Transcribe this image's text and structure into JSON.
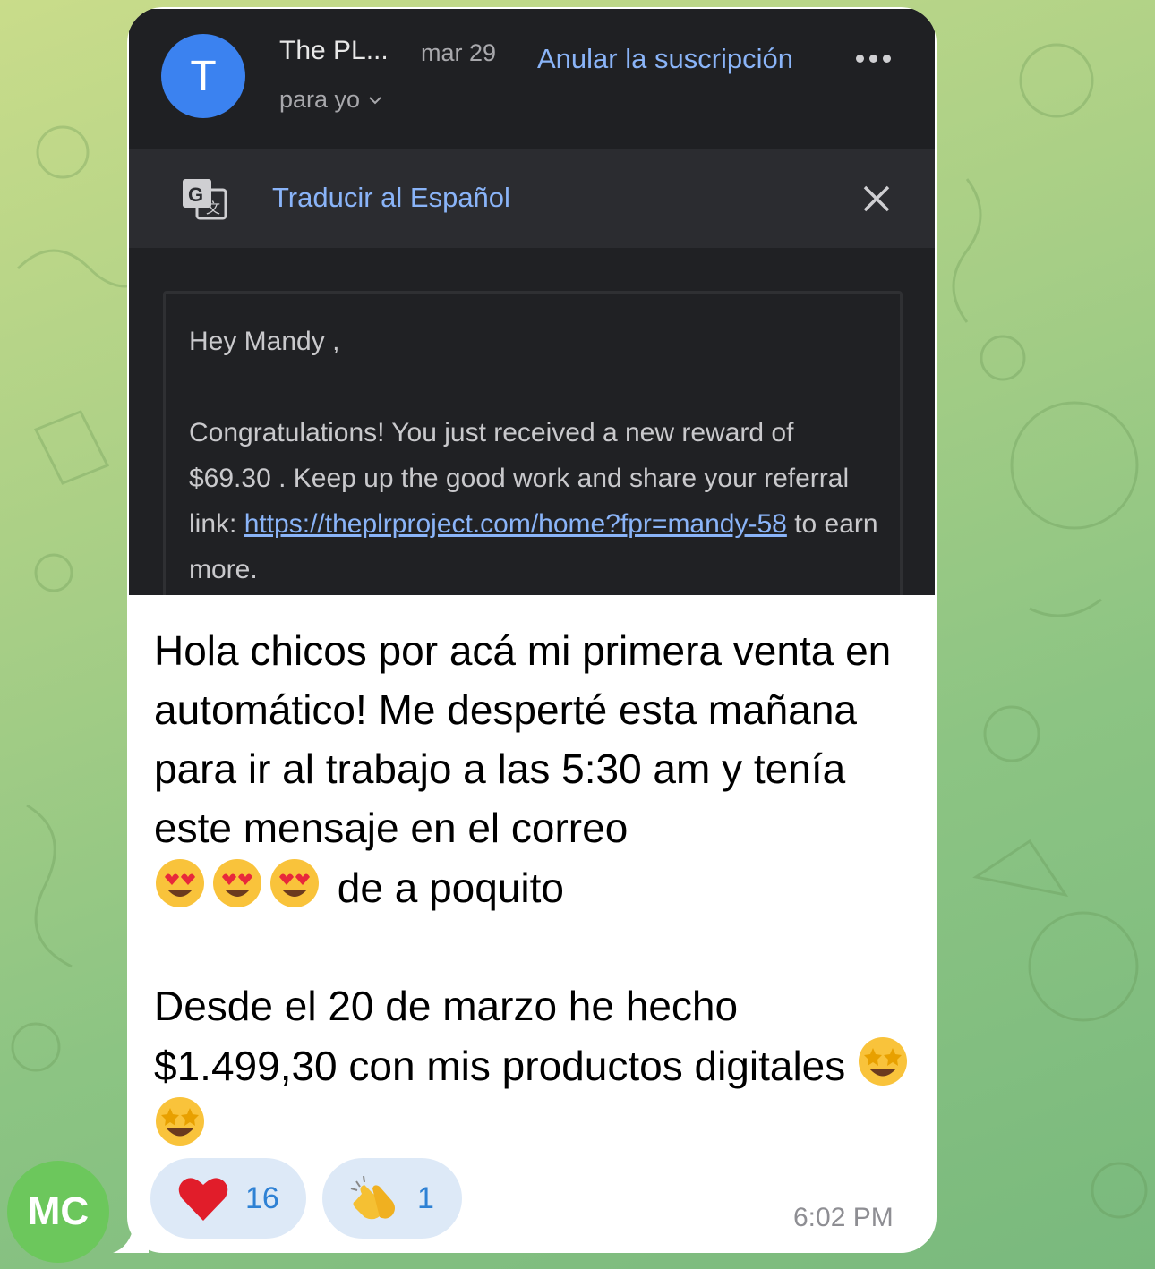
{
  "email": {
    "avatar_letter": "T",
    "sender": "The PL...",
    "date": "mar 29",
    "recipient": "para yo",
    "unsubscribe": "Anular la suscripción",
    "translate_label": "Traducir al Español",
    "greeting": "Hey Mandy ,",
    "body_1": "Congratulations! You just received a new reward of $69.30 . Keep up the good work and share your referral link:",
    "link": "https://theplrproject.com/home?fpr=mandy-58",
    "body_2": "to earn more."
  },
  "message": {
    "line_1": "Hola chicos por acá mi primera venta en automático! Me desperté esta mañana para ir al trabajo a las 5:30 am y tenía este mensaje en el correo",
    "line_1_tail": "de a poquito",
    "line_2": "Desde el 20 de marzo he hecho $1.499,30 con mis productos digitales",
    "emoji_1": "heart-eyes-face",
    "emoji_2": "star-struck-face"
  },
  "reactions": [
    {
      "icon": "red-heart-icon",
      "count": "16"
    },
    {
      "icon": "clapping-hands-icon",
      "count": "1"
    }
  ],
  "time": "6:02 PM",
  "sender_avatar": "MC",
  "colors": {
    "link_blue": "#8ab4f8",
    "reaction_blue": "#2e81d4",
    "avatar_green": "#6cc75c",
    "avatar_blue": "#3b82f0"
  }
}
